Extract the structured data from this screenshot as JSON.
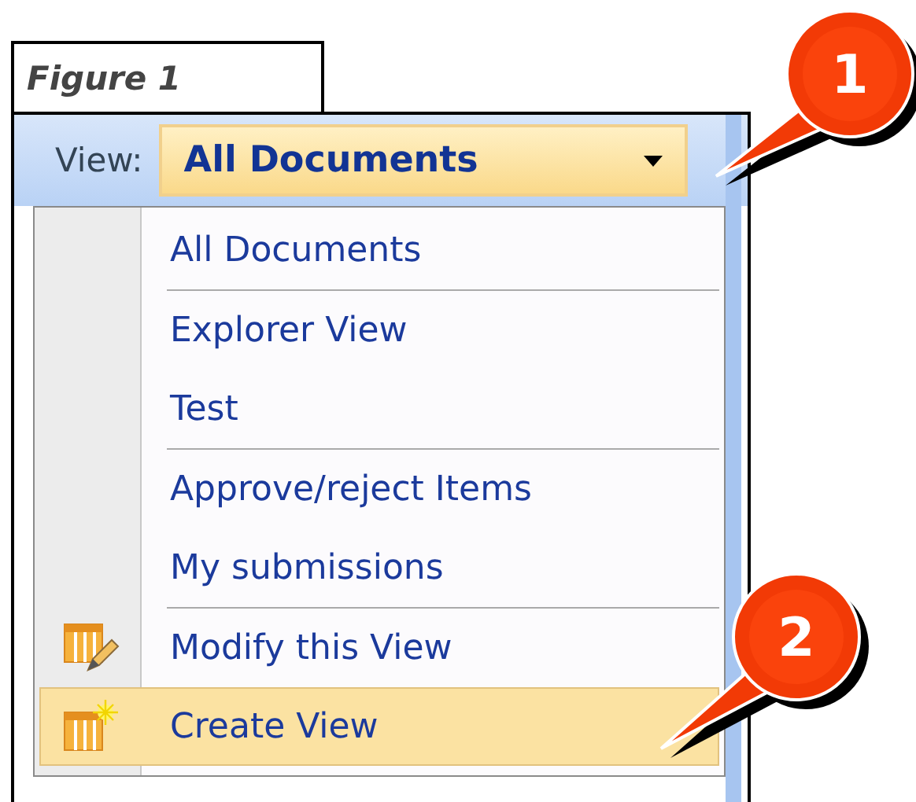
{
  "figure_label": "Figure 1",
  "view_bar": {
    "label": "View:",
    "dropdown_value": "All Documents"
  },
  "menu": {
    "groups": [
      {
        "items": [
          {
            "label": "All Documents",
            "kind": "plain",
            "selected": false
          }
        ]
      },
      {
        "items": [
          {
            "label": "Explorer View",
            "kind": "plain",
            "selected": false
          },
          {
            "label": "Test",
            "kind": "plain",
            "selected": false
          }
        ]
      },
      {
        "items": [
          {
            "label": "Approve/reject Items",
            "kind": "plain",
            "selected": false
          },
          {
            "label": "My submissions",
            "kind": "plain",
            "selected": false
          }
        ]
      },
      {
        "items": [
          {
            "label": "Modify this View",
            "kind": "modify",
            "selected": false
          },
          {
            "label": "Create View",
            "kind": "create",
            "selected": true
          }
        ]
      }
    ]
  },
  "callouts": [
    {
      "number": "1"
    },
    {
      "number": "2"
    }
  ]
}
